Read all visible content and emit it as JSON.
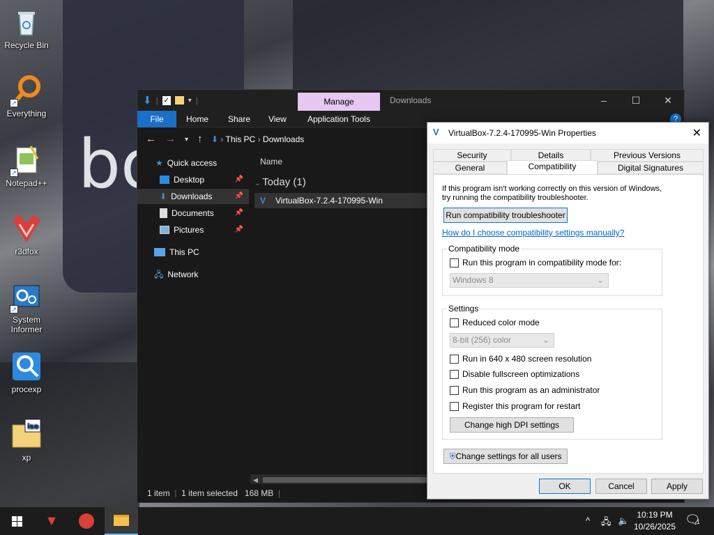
{
  "desktop": {
    "icons": [
      {
        "label": "Recycle Bin",
        "icon": "recycle-bin-icon"
      },
      {
        "label": "Everything",
        "icon": "magnifier-orange-icon"
      },
      {
        "label": "Notepad++",
        "icon": "notepad-plus-icon"
      },
      {
        "label": "r3dfox",
        "icon": "r3dfox-icon"
      },
      {
        "label": "System Informer",
        "icon": "system-informer-icon"
      },
      {
        "label": "procexp",
        "icon": "procexp-icon"
      },
      {
        "label": "xp",
        "icon": "iso-folder-icon"
      }
    ],
    "wallpaper_text": "bo"
  },
  "explorer": {
    "title": "Downloads",
    "manage_tab": "Manage",
    "ribbon_tabs": [
      "File",
      "Home",
      "Share",
      "View",
      "Application Tools"
    ],
    "breadcrumb": [
      "This PC",
      "Downloads"
    ],
    "nav": {
      "quick_access": "Quick access",
      "items": [
        "Desktop",
        "Downloads",
        "Documents",
        "Pictures"
      ],
      "this_pc": "This PC",
      "network": "Network"
    },
    "column_name": "Name",
    "group_label": "Today (1)",
    "file_name": "VirtualBox-7.2.4-170995-Win",
    "status": {
      "items": "1 item",
      "selected": "1 item selected",
      "size": "168 MB"
    },
    "accent": "#1a6fc6"
  },
  "properties": {
    "title": "VirtualBox-7.2.4-170995-Win Properties",
    "tabs_row1": [
      "Security",
      "Details",
      "Previous Versions"
    ],
    "tabs_row2": [
      "General",
      "Compatibility",
      "Digital Signatures"
    ],
    "active_tab": "Compatibility",
    "intro_line1": "If this program isn't working correctly on this version of Windows,",
    "intro_line2": "try running the compatibility troubleshooter.",
    "run_troubleshooter": "Run compatibility troubleshooter",
    "help_link": "How do I choose compatibility settings manually?",
    "compat_mode": {
      "group": "Compatibility mode",
      "checkbox": "Run this program in compatibility mode for:",
      "checked": false,
      "os_value": "Windows 8"
    },
    "settings": {
      "group": "Settings",
      "reduced_color": "Reduced color mode",
      "color_value": "8-bit (256) color",
      "run_640": "Run in 640 x 480 screen resolution",
      "disable_fullscreen": "Disable fullscreen optimizations",
      "run_admin": "Run this program as an administrator",
      "register_restart": "Register this program for restart",
      "dpi_button": "Change high DPI settings"
    },
    "change_all_users": "Change settings for all users",
    "ok": "OK",
    "cancel": "Cancel",
    "apply": "Apply"
  },
  "taskbar": {
    "time": "10:19 PM",
    "date": "10/26/2025",
    "notification_count": "1"
  }
}
